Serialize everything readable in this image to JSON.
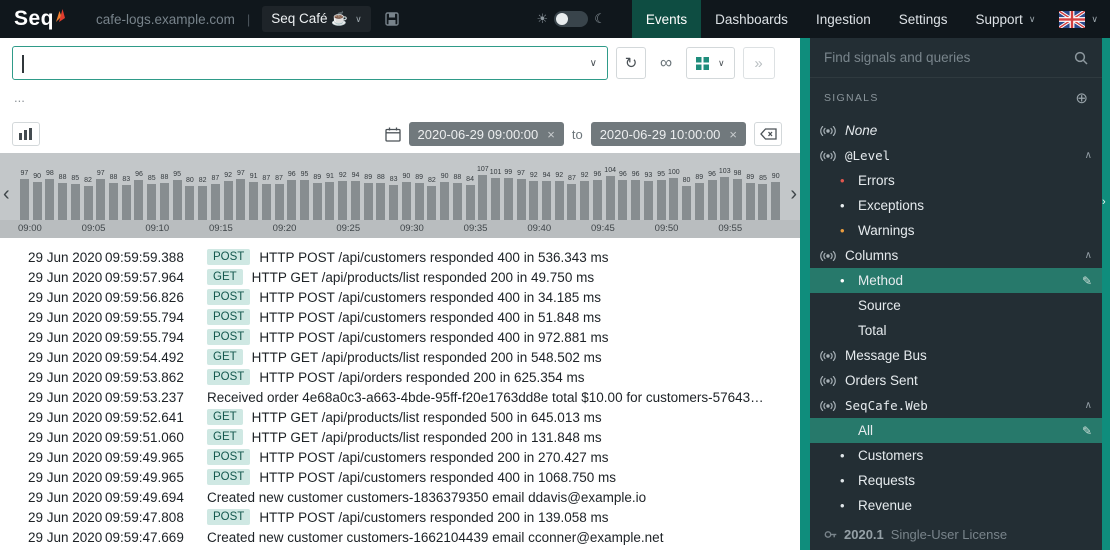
{
  "topbar": {
    "logo_text": "Seq",
    "hostname": "cafe-logs.example.com",
    "separator": "|",
    "workspace_label": "Seq Café ☕",
    "nav": [
      {
        "label": "Events",
        "active": true
      },
      {
        "label": "Dashboards",
        "active": false
      },
      {
        "label": "Ingestion",
        "active": false
      },
      {
        "label": "Settings",
        "active": false
      },
      {
        "label": "Support",
        "active": false,
        "dropdown": true
      }
    ]
  },
  "toolbar": {
    "search_value": "",
    "results_hint": "...",
    "range_from": "2020-06-29 09:00:00",
    "range_separator": "to",
    "range_to": "2020-06-29 10:00:00"
  },
  "chart_data": {
    "type": "bar",
    "description": "Events per one-minute bucket, 09:00 to 10:00",
    "tick_labels": [
      "09:00",
      "09:05",
      "09:10",
      "09:15",
      "09:20",
      "09:25",
      "09:30",
      "09:35",
      "09:40",
      "09:45",
      "09:50",
      "09:55"
    ],
    "values": [
      97,
      90,
      98,
      88,
      85,
      82,
      97,
      88,
      83,
      96,
      85,
      88,
      95,
      80,
      82,
      87,
      92,
      97,
      91,
      87,
      87,
      96,
      95,
      89,
      91,
      92,
      94,
      89,
      88,
      83,
      90,
      89,
      82,
      90,
      88,
      84,
      107,
      101,
      99,
      97,
      92,
      94,
      92,
      87,
      92,
      96,
      104,
      96,
      96,
      93,
      95,
      100,
      80,
      89,
      96,
      103,
      98,
      89,
      85,
      90
    ],
    "ylim": [
      0,
      110
    ],
    "grid": false,
    "legend": false
  },
  "events": [
    {
      "date": "29 Jun 2020",
      "time": "09:59:59.388",
      "method": "POST",
      "message": "HTTP POST /api/customers responded 400 in 536.343 ms"
    },
    {
      "date": "29 Jun 2020",
      "time": "09:59:57.964",
      "method": "GET",
      "message": "HTTP GET /api/products/list responded 200 in 49.750 ms"
    },
    {
      "date": "29 Jun 2020",
      "time": "09:59:56.826",
      "method": "POST",
      "message": "HTTP POST /api/customers responded 400 in 34.185 ms"
    },
    {
      "date": "29 Jun 2020",
      "time": "09:59:55.794",
      "method": "POST",
      "message": "HTTP POST /api/customers responded 400 in 51.848 ms"
    },
    {
      "date": "29 Jun 2020",
      "time": "09:59:55.794",
      "method": "POST",
      "message": "HTTP POST /api/customers responded 400 in 972.881 ms"
    },
    {
      "date": "29 Jun 2020",
      "time": "09:59:54.492",
      "method": "GET",
      "message": "HTTP GET /api/products/list responded 200 in 548.502 ms"
    },
    {
      "date": "29 Jun 2020",
      "time": "09:59:53.862",
      "method": "POST",
      "message": "HTTP POST /api/orders responded 200 in 625.354 ms"
    },
    {
      "date": "29 Jun 2020",
      "time": "09:59:53.237",
      "method": null,
      "message": "Received order 4e68a0c3-a663-4bde-95ff-f20e1763dd8e total $10.00 for customers-57643…"
    },
    {
      "date": "29 Jun 2020",
      "time": "09:59:52.641",
      "method": "GET",
      "message": "HTTP GET /api/products/list responded 500 in 645.013 ms"
    },
    {
      "date": "29 Jun 2020",
      "time": "09:59:51.060",
      "method": "GET",
      "message": "HTTP GET /api/products/list responded 200 in 131.848 ms"
    },
    {
      "date": "29 Jun 2020",
      "time": "09:59:49.965",
      "method": "POST",
      "message": "HTTP POST /api/customers responded 200 in 270.427 ms"
    },
    {
      "date": "29 Jun 2020",
      "time": "09:59:49.965",
      "method": "POST",
      "message": "HTTP POST /api/customers responded 400 in 1068.750 ms"
    },
    {
      "date": "29 Jun 2020",
      "time": "09:59:49.694",
      "method": null,
      "message": "Created new customer customers-1836379350 email ddavis@example.io"
    },
    {
      "date": "29 Jun 2020",
      "time": "09:59:47.808",
      "method": "POST",
      "message": "HTTP POST /api/customers responded 200 in 139.058 ms"
    },
    {
      "date": "29 Jun 2020",
      "time": "09:59:47.669",
      "method": null,
      "message": "Created new customer customers-1662104439 email cconner@example.net"
    }
  ],
  "sidebar": {
    "search_placeholder": "Find signals and queries",
    "section_label": "SIGNALS",
    "items": [
      {
        "type": "signal",
        "label": "None",
        "italic": true
      },
      {
        "type": "group",
        "label": "@Level",
        "mono": true,
        "expanded": true
      },
      {
        "type": "child",
        "label": "Errors",
        "bullet_color": "#e2574e"
      },
      {
        "type": "child",
        "label": "Exceptions",
        "bullet_color": "#e8edef"
      },
      {
        "type": "child",
        "label": "Warnings",
        "bullet_color": "#eb9d3e"
      },
      {
        "type": "group",
        "label": "Columns",
        "expanded": true
      },
      {
        "type": "child",
        "label": "Method",
        "bullet_color": "#ffffff",
        "selected": true,
        "editable": true
      },
      {
        "type": "child",
        "label": "Source"
      },
      {
        "type": "child",
        "label": "Total"
      },
      {
        "type": "signal",
        "label": "Message Bus"
      },
      {
        "type": "signal",
        "label": "Orders Sent"
      },
      {
        "type": "group",
        "label": "SeqCafe.Web",
        "mono": true,
        "expanded": true
      },
      {
        "type": "child",
        "label": "All",
        "selected": true,
        "editable": true
      },
      {
        "type": "child",
        "label": "Customers",
        "bullet_color": "#dfe5e8"
      },
      {
        "type": "child",
        "label": "Requests",
        "bullet_color": "#dfe5e8"
      },
      {
        "type": "child",
        "label": "Revenue",
        "bullet_color": "#dfe5e8"
      }
    ],
    "license": {
      "version": "2020.1",
      "text": "Single-User License"
    }
  },
  "icons": {
    "refresh": "↻",
    "infinity": "∞",
    "chevron_down": "∨",
    "chevron_up": "∧",
    "more": "»",
    "close": "×",
    "pencil": "✎",
    "plus_circle": "⊕",
    "sun": "☀",
    "moon": "☾",
    "bullet": "•",
    "prev": "‹",
    "next": "›"
  },
  "colors": {
    "accent_teal": "#0f8d7c",
    "selected_signal": "#27796b",
    "active_tab": "#0e4d42",
    "badge_bg": "#cfe8e3",
    "badge_text": "#14584e",
    "error_red": "#e2574e",
    "warning_orange": "#eb9d3e"
  }
}
